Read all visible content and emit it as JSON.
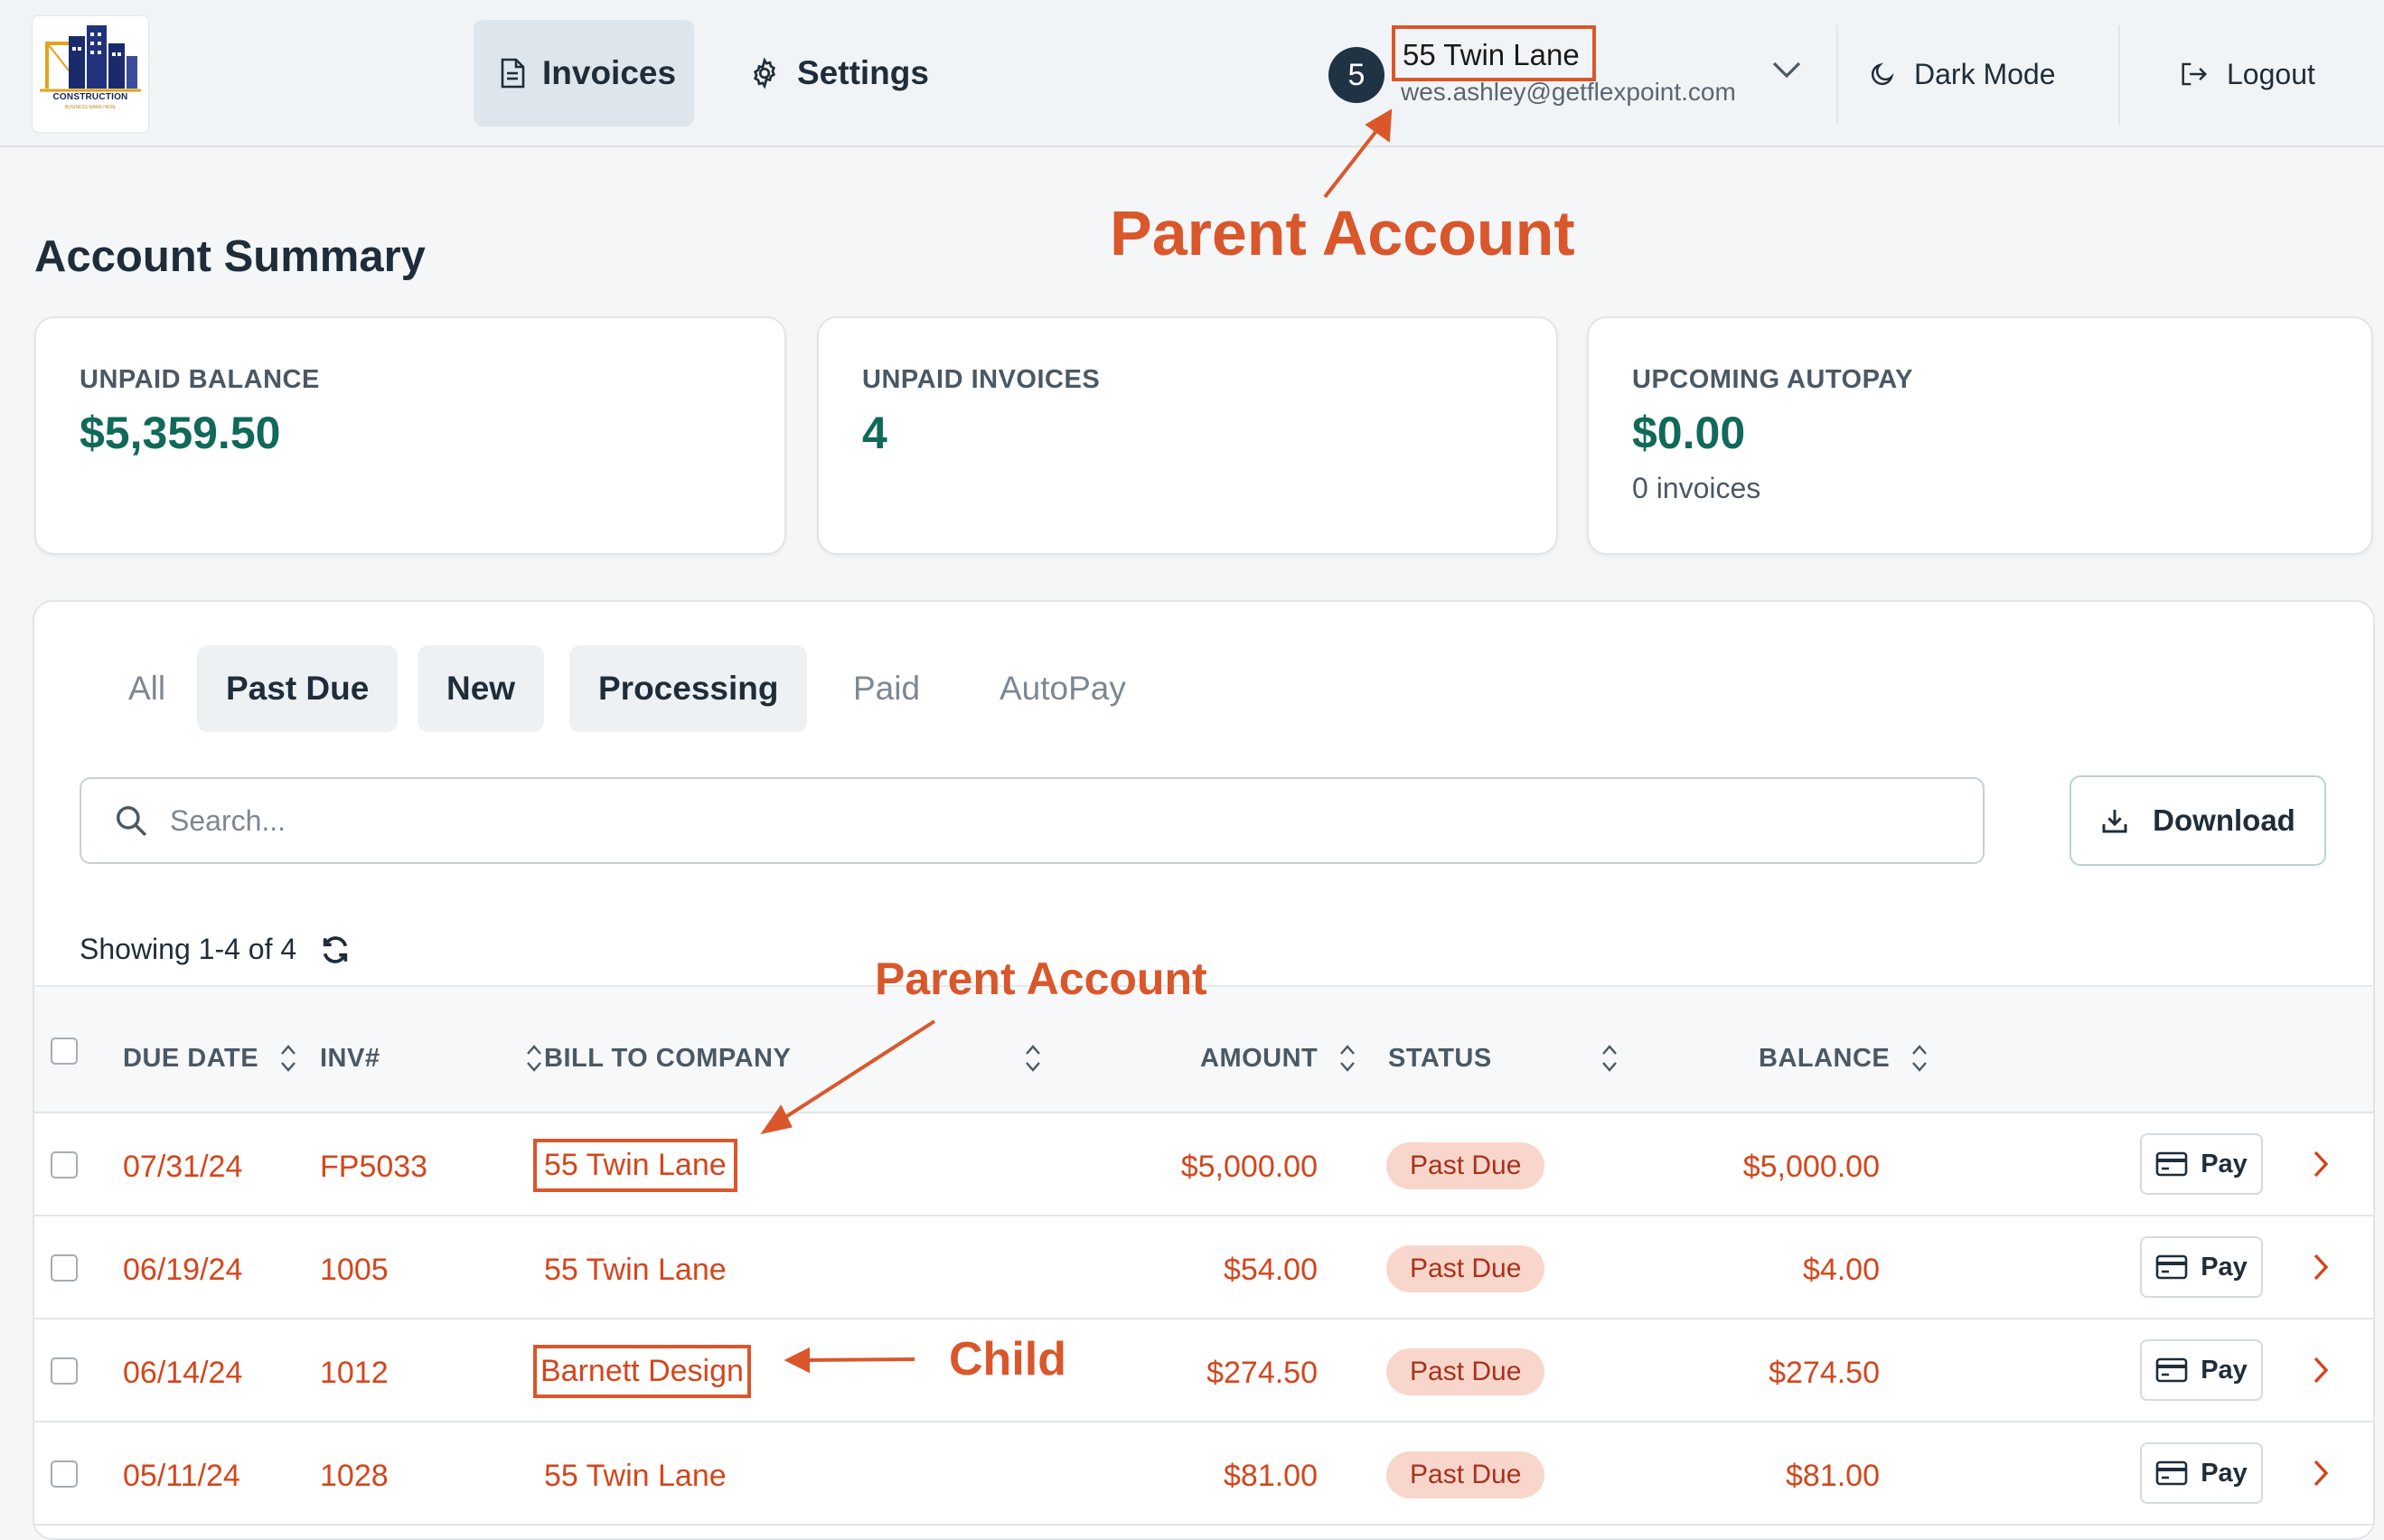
{
  "header": {
    "logo_text": "CONSTRUCTION",
    "logo_subtext": "BUSINESS NAME HERE",
    "nav": [
      {
        "label": "Invoices",
        "icon": "document-icon",
        "active": true
      },
      {
        "label": "Settings",
        "icon": "gear-icon",
        "active": false
      }
    ],
    "account": {
      "badge": "5",
      "name": "55 Twin Lane",
      "email": "wes.ashley@getflexpoint.com"
    },
    "dark_mode_label": "Dark Mode",
    "logout_label": "Logout"
  },
  "annotations": {
    "header_parent": "Parent Account",
    "table_parent": "Parent Account",
    "child": "Child"
  },
  "summary": {
    "title": "Account Summary",
    "cards": [
      {
        "label": "UNPAID BALANCE",
        "value": "$5,359.50",
        "sub": ""
      },
      {
        "label": "UNPAID INVOICES",
        "value": "4",
        "sub": ""
      },
      {
        "label": "UPCOMING AUTOPAY",
        "value": "$0.00",
        "sub": "0 invoices"
      }
    ]
  },
  "filters": [
    {
      "label": "All",
      "active": false
    },
    {
      "label": "Past Due",
      "active": true
    },
    {
      "label": "New",
      "active": true
    },
    {
      "label": "Processing",
      "active": true
    },
    {
      "label": "Paid",
      "active": false
    },
    {
      "label": "AutoPay",
      "active": false
    }
  ],
  "search": {
    "placeholder": "Search...",
    "value": ""
  },
  "download_label": "Download",
  "showing_text": "Showing 1-4 of 4",
  "table": {
    "columns": [
      "DUE DATE",
      "INV#",
      "BILL TO COMPANY",
      "AMOUNT",
      "STATUS",
      "BALANCE"
    ],
    "rows": [
      {
        "due": "07/31/24",
        "inv": "FP5033",
        "company": "55 Twin Lane",
        "amount": "$5,000.00",
        "status": "Past Due",
        "balance": "$5,000.00"
      },
      {
        "due": "06/19/24",
        "inv": "1005",
        "company": "55 Twin Lane",
        "amount": "$54.00",
        "status": "Past Due",
        "balance": "$4.00"
      },
      {
        "due": "06/14/24",
        "inv": "1012",
        "company": "Barnett Design",
        "amount": "$274.50",
        "status": "Past Due",
        "balance": "$274.50"
      },
      {
        "due": "05/11/24",
        "inv": "1028",
        "company": "55 Twin Lane",
        "amount": "$81.00",
        "status": "Past Due",
        "balance": "$81.00"
      }
    ],
    "pay_label": "Pay"
  },
  "colors": {
    "accent_green": "#11695a",
    "past_due_red": "#d4461c",
    "annotation_orange": "#d9572b",
    "status_badge_bg": "#f9d6cc"
  }
}
